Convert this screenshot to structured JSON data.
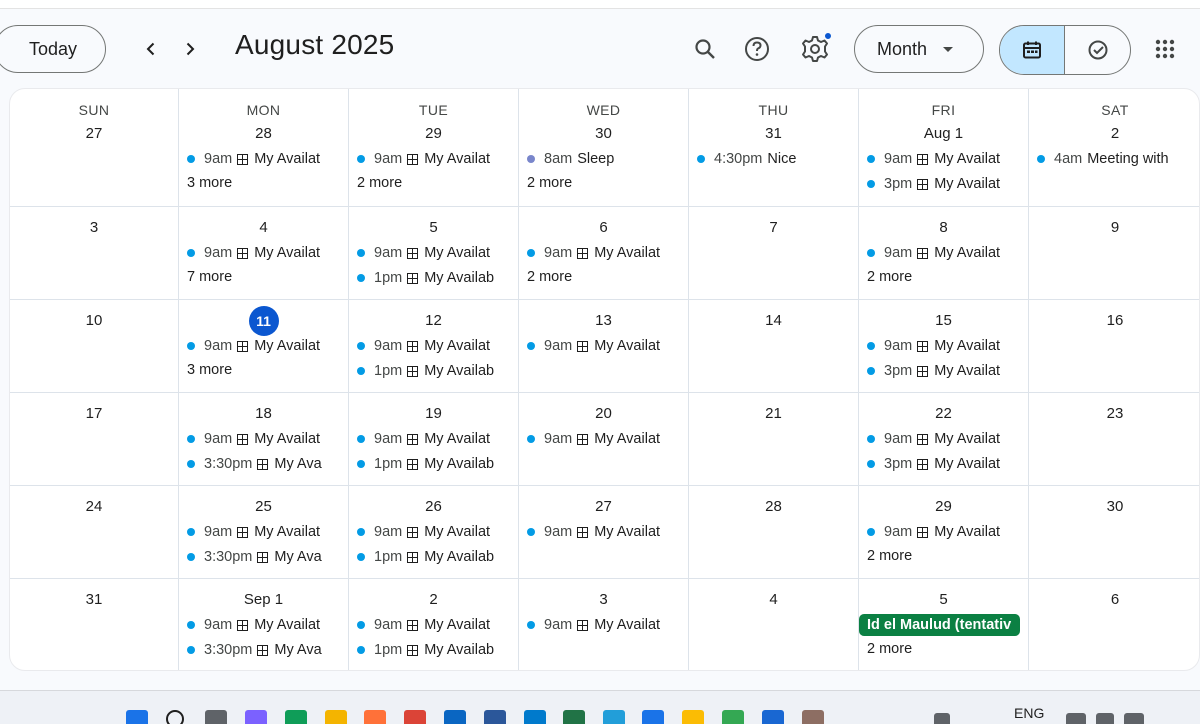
{
  "header": {
    "today_label": "Today",
    "month_title": "August 2025",
    "view_label": "Month"
  },
  "icons": {
    "prev": "chevron-left-icon",
    "next": "chevron-right-icon",
    "search": "search-icon",
    "help": "help-icon",
    "settings": "gear-icon",
    "calendar_view": "calendar-icon",
    "tasks_view": "check-circle-icon",
    "apps": "apps-grid-icon"
  },
  "colors": {
    "event_dot": "#039be5",
    "sleep_dot": "#7986cb",
    "holiday_chip": "#0b8043",
    "today_circle": "#0b57d0",
    "active_view": "#c2e7ff"
  },
  "weekdays": [
    "SUN",
    "MON",
    "TUE",
    "WED",
    "THU",
    "FRI",
    "SAT"
  ],
  "weeks": [
    [
      {
        "num": "27",
        "events": [],
        "more": ""
      },
      {
        "num": "28",
        "events": [
          {
            "time": "9am",
            "title": "My Availat",
            "grid": true
          }
        ],
        "more": "3 more"
      },
      {
        "num": "29",
        "events": [
          {
            "time": "9am",
            "title": "My Availat",
            "grid": true
          }
        ],
        "more": "2 more"
      },
      {
        "num": "30",
        "events": [
          {
            "time": "8am",
            "title": "Sleep",
            "grid": false,
            "dot": "lav"
          }
        ],
        "more": "2 more"
      },
      {
        "num": "31",
        "events": [
          {
            "time": "4:30pm",
            "title": "Nice",
            "grid": false
          }
        ],
        "more": ""
      },
      {
        "num": "Aug 1",
        "events": [
          {
            "time": "9am",
            "title": "My Availat",
            "grid": true
          },
          {
            "time": "3pm",
            "title": "My Availat",
            "grid": true
          }
        ],
        "more": ""
      },
      {
        "num": "2",
        "events": [
          {
            "time": "4am",
            "title": "Meeting with",
            "grid": false
          }
        ],
        "more": ""
      }
    ],
    [
      {
        "num": "3",
        "events": [],
        "more": ""
      },
      {
        "num": "4",
        "events": [
          {
            "time": "9am",
            "title": "My Availat",
            "grid": true
          }
        ],
        "more": "7 more"
      },
      {
        "num": "5",
        "events": [
          {
            "time": "9am",
            "title": "My Availat",
            "grid": true
          },
          {
            "time": "1pm",
            "title": "My Availab",
            "grid": true
          }
        ],
        "more": ""
      },
      {
        "num": "6",
        "events": [
          {
            "time": "9am",
            "title": "My Availat",
            "grid": true
          }
        ],
        "more": "2 more"
      },
      {
        "num": "7",
        "events": [],
        "more": ""
      },
      {
        "num": "8",
        "events": [
          {
            "time": "9am",
            "title": "My Availat",
            "grid": true
          }
        ],
        "more": "2 more"
      },
      {
        "num": "9",
        "events": [],
        "more": ""
      }
    ],
    [
      {
        "num": "10",
        "events": [],
        "more": ""
      },
      {
        "num": "11",
        "today": true,
        "events": [
          {
            "time": "9am",
            "title": "My Availat",
            "grid": true
          }
        ],
        "more": "3 more"
      },
      {
        "num": "12",
        "events": [
          {
            "time": "9am",
            "title": "My Availat",
            "grid": true
          },
          {
            "time": "1pm",
            "title": "My Availab",
            "grid": true
          }
        ],
        "more": ""
      },
      {
        "num": "13",
        "events": [
          {
            "time": "9am",
            "title": "My Availat",
            "grid": true
          }
        ],
        "more": ""
      },
      {
        "num": "14",
        "events": [],
        "more": ""
      },
      {
        "num": "15",
        "events": [
          {
            "time": "9am",
            "title": "My Availat",
            "grid": true
          },
          {
            "time": "3pm",
            "title": "My Availat",
            "grid": true
          }
        ],
        "more": ""
      },
      {
        "num": "16",
        "events": [],
        "more": ""
      }
    ],
    [
      {
        "num": "17",
        "events": [],
        "more": ""
      },
      {
        "num": "18",
        "events": [
          {
            "time": "9am",
            "title": "My Availat",
            "grid": true
          },
          {
            "time": "3:30pm",
            "title": "My Ava",
            "grid": true
          }
        ],
        "more": ""
      },
      {
        "num": "19",
        "events": [
          {
            "time": "9am",
            "title": "My Availat",
            "grid": true
          },
          {
            "time": "1pm",
            "title": "My Availab",
            "grid": true
          }
        ],
        "more": ""
      },
      {
        "num": "20",
        "events": [
          {
            "time": "9am",
            "title": "My Availat",
            "grid": true
          }
        ],
        "more": ""
      },
      {
        "num": "21",
        "events": [],
        "more": ""
      },
      {
        "num": "22",
        "events": [
          {
            "time": "9am",
            "title": "My Availat",
            "grid": true
          },
          {
            "time": "3pm",
            "title": "My Availat",
            "grid": true
          }
        ],
        "more": ""
      },
      {
        "num": "23",
        "events": [],
        "more": ""
      }
    ],
    [
      {
        "num": "24",
        "events": [],
        "more": ""
      },
      {
        "num": "25",
        "events": [
          {
            "time": "9am",
            "title": "My Availat",
            "grid": true
          },
          {
            "time": "3:30pm",
            "title": "My Ava",
            "grid": true
          }
        ],
        "more": ""
      },
      {
        "num": "26",
        "events": [
          {
            "time": "9am",
            "title": "My Availat",
            "grid": true
          },
          {
            "time": "1pm",
            "title": "My Availab",
            "grid": true
          }
        ],
        "more": ""
      },
      {
        "num": "27",
        "events": [
          {
            "time": "9am",
            "title": "My Availat",
            "grid": true
          }
        ],
        "more": ""
      },
      {
        "num": "28",
        "events": [],
        "more": ""
      },
      {
        "num": "29",
        "events": [
          {
            "time": "9am",
            "title": "My Availat",
            "grid": true
          }
        ],
        "more": "2 more"
      },
      {
        "num": "30",
        "events": [],
        "more": ""
      }
    ],
    [
      {
        "num": "31",
        "events": [],
        "more": ""
      },
      {
        "num": "Sep 1",
        "events": [
          {
            "time": "9am",
            "title": "My Availat",
            "grid": true
          },
          {
            "time": "3:30pm",
            "title": "My Ava",
            "grid": true
          }
        ],
        "more": ""
      },
      {
        "num": "2",
        "events": [
          {
            "time": "9am",
            "title": "My Availat",
            "grid": true
          },
          {
            "time": "1pm",
            "title": "My Availab",
            "grid": true
          }
        ],
        "more": ""
      },
      {
        "num": "3",
        "events": [
          {
            "time": "9am",
            "title": "My Availat",
            "grid": true
          }
        ],
        "more": ""
      },
      {
        "num": "4",
        "events": [],
        "more": ""
      },
      {
        "num": "5",
        "allday": "Id el Maulud (tentativ",
        "events": [],
        "more": "2 more"
      },
      {
        "num": "6",
        "events": [],
        "more": ""
      }
    ]
  ],
  "taskbar": {
    "language": "ENG",
    "apps": [
      "windows-start-icon",
      "search-icon",
      "task-view-icon",
      "copilot-icon",
      "edge-icon",
      "file-explorer-icon",
      "firefox-icon",
      "chrome-icon",
      "linkedin-icon",
      "word-icon",
      "vscode-icon",
      "excel-icon",
      "telegram-icon",
      "calendar-app-icon",
      "chrome-canary-icon",
      "globe-icon",
      "photos-icon",
      "app-icon"
    ]
  }
}
